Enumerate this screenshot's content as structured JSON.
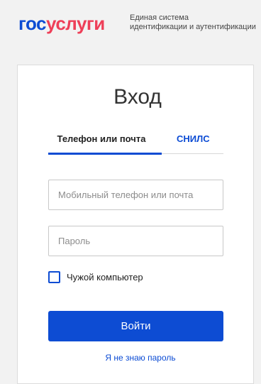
{
  "header": {
    "logo_part1": "гос",
    "logo_part2": "услуги",
    "tagline_line1": "Единая система",
    "tagline_line2": "идентификации и аутентификации"
  },
  "login": {
    "title": "Вход",
    "tabs": [
      {
        "label": "Телефон или почта",
        "active": true
      },
      {
        "label": "СНИЛС",
        "active": false
      }
    ],
    "phone_placeholder": "Мобильный телефон или почта",
    "password_placeholder": "Пароль",
    "checkbox_label": "Чужой компьютер",
    "submit_label": "Войти",
    "forgot_label": "Я не знаю пароль"
  },
  "colors": {
    "brand_blue": "#0d4cd3",
    "brand_red": "#ee3f58"
  }
}
